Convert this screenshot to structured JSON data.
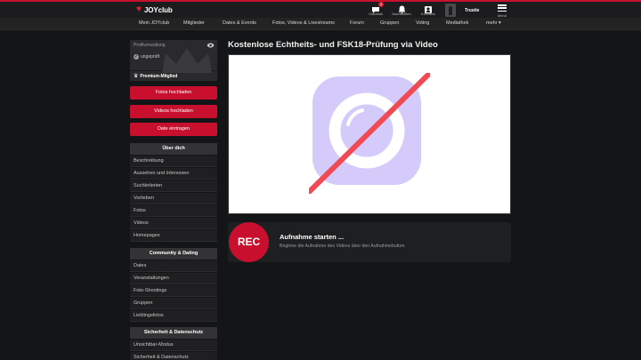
{
  "header": {
    "logo_text": "JOYclub",
    "icons": [
      {
        "name": "clubmail-icon",
        "label": "ClubMail",
        "badge": "1"
      },
      {
        "name": "bell-icon",
        "label": "Nachrichten"
      },
      {
        "name": "contacts-icon",
        "label": "Kontakte"
      }
    ],
    "user_name": "Trustie",
    "menu_label": "Menü"
  },
  "nav": {
    "items": [
      "Mein JOYclub",
      "Mitglieder",
      "Dates & Events",
      "Fotos, Videos & Livestreams",
      "Forum",
      "Gruppen",
      "Voting",
      "Mediathek"
    ],
    "more": "mehr ▾"
  },
  "profile": {
    "label": "Profilverwaltung",
    "status": "ungeprüft",
    "premium": "Premium-Mitglied"
  },
  "actions": [
    "Fotos hochladen",
    "Videos hochladen",
    "Date eintragen"
  ],
  "sections": [
    {
      "title": "Über dich",
      "items": [
        "Beschreibung",
        "Aussehen und Interessen",
        "Suchkriterien",
        "Vorlieben",
        "Fotos",
        "Videos",
        "Homepages"
      ]
    },
    {
      "title": "Community & Dating",
      "items": [
        "Dates",
        "Veranstaltungen",
        "Foto-Shootings",
        "Gruppen",
        "Lieblingsfotos"
      ]
    },
    {
      "title": "Sicherheit & Datenschutz",
      "items": [
        "Unsichtbar-Modus",
        "Sicherheit & Datenschutz"
      ]
    }
  ],
  "main": {
    "title": "Kostenlose Echtheits- und FSK18-Prüfung via Video",
    "rec_label": "REC",
    "rec_title": "Aufnahme starten ...",
    "rec_desc": "Beginne die Aufnahme des Videos über den Aufnahmebutton."
  },
  "colors": {
    "accent": "#c8102e",
    "camera_bg": "#d4cbfa",
    "slash": "#f04a55"
  }
}
